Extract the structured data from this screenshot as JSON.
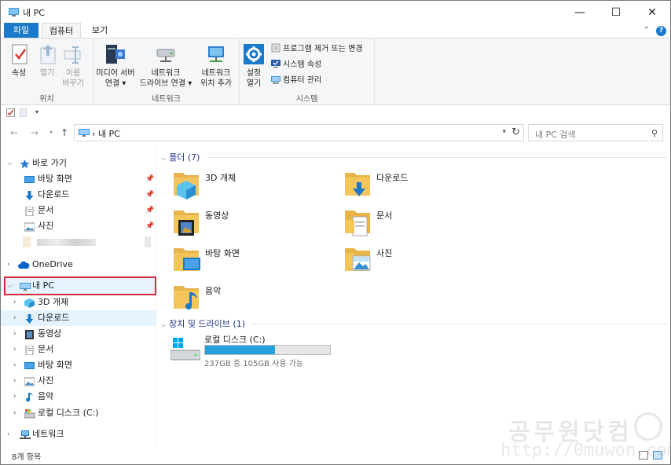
{
  "window": {
    "title": "내 PC",
    "controls": {
      "minimize": "—",
      "maximize": "☐",
      "close": "✕"
    }
  },
  "ribbon_tabs": {
    "file": "파일",
    "computer": "컴퓨터",
    "view": "보기",
    "collapse": "⌃",
    "help": "?"
  },
  "ribbon": {
    "location": {
      "label": "위치",
      "properties": "속성",
      "open": "열기",
      "rename_1": "이름",
      "rename_2": "바꾸기"
    },
    "network": {
      "label": "네트워크",
      "media_1": "미디어 서버",
      "media_2": "연결",
      "map_1": "네트워크",
      "map_2": "드라이브 연결",
      "add_1": "네트워크",
      "add_2": "위치 추가"
    },
    "system": {
      "label": "시스템",
      "settings_1": "설정",
      "settings_2": "열기",
      "uninstall": "프로그램 제거 또는 변경",
      "system_props": "시스템 속성",
      "manage": "컴퓨터 관리"
    }
  },
  "address": {
    "separator": "›",
    "crumb": "내 PC",
    "search_placeholder": "내 PC 검색"
  },
  "nav": {
    "quick_access": "바로 가기",
    "quick_items": [
      "바탕 화면",
      "다운로드",
      "문서",
      "사진"
    ],
    "onedrive": "OneDrive",
    "this_pc": "내 PC",
    "pc_items": [
      "3D 개체",
      "다운로드",
      "동영상",
      "문서",
      "바탕 화면",
      "사진",
      "음악",
      "로컬 디스크 (C:)"
    ],
    "network": "네트워크"
  },
  "content": {
    "folders_header": "폴더 (7)",
    "folders": [
      "3D 개체",
      "다운로드",
      "동영상",
      "문서",
      "바탕 화면",
      "사진",
      "음악"
    ],
    "drives_header": "장치 및 드라이브 (1)",
    "drive": {
      "name": "로컬 디스크 (C:)",
      "free_text": "237GB 중 105GB 사용 가능",
      "used_fraction": 0.557
    }
  },
  "status": {
    "count": "8개 항목"
  },
  "watermark": {
    "title": "공무원닷컴",
    "url": "http://0muwon.com"
  },
  "colors": {
    "accent": "#1979ca",
    "selection": "#e5f3ff",
    "highlight_box": "#d12d3a",
    "drive_bar": "#26a0da",
    "folder": "#f4c55a"
  }
}
